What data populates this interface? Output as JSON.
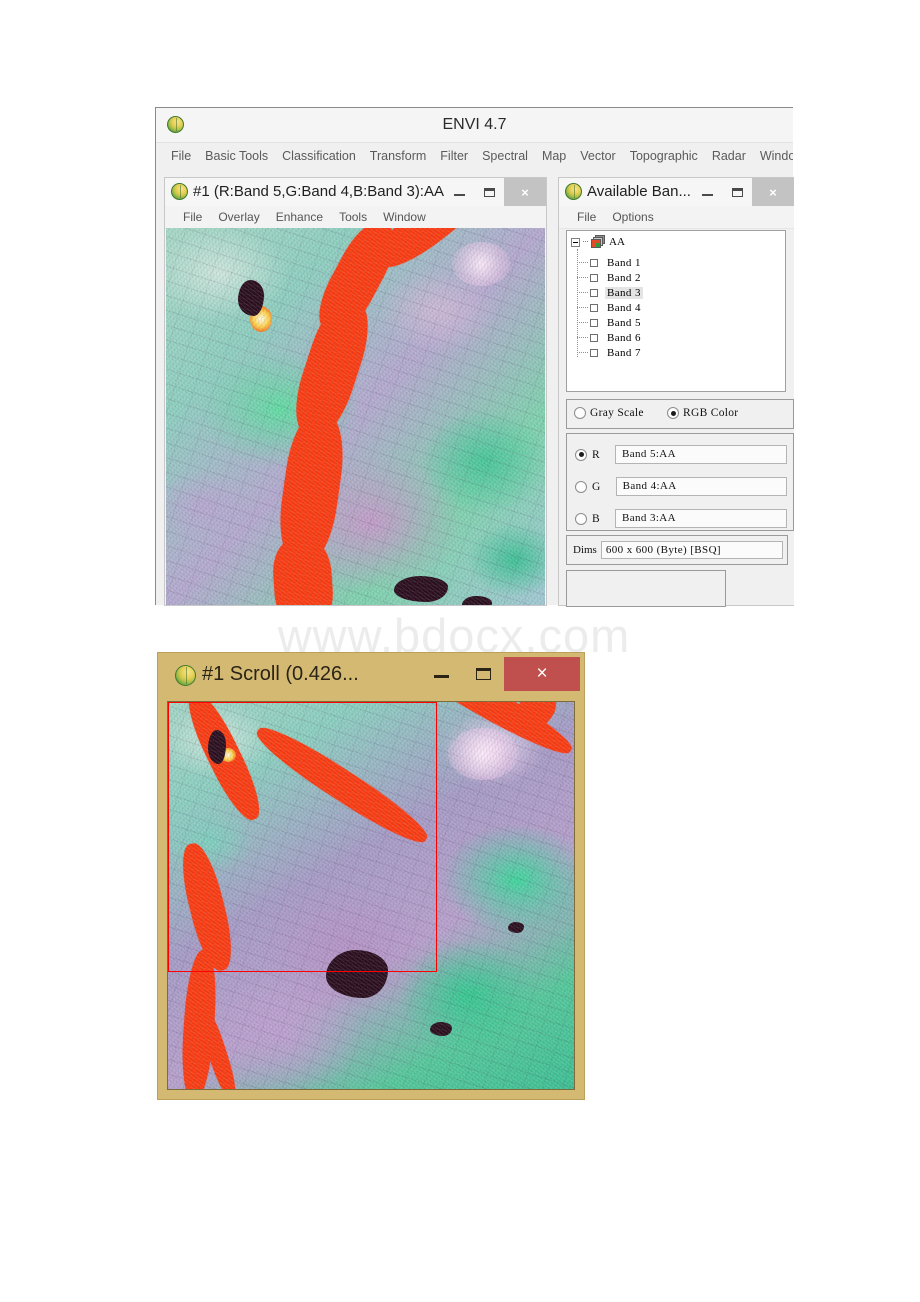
{
  "app": {
    "title": "ENVI 4.7",
    "logo_icon": "envi-globe-icon",
    "menu": [
      "File",
      "Basic Tools",
      "Classification",
      "Transform",
      "Filter",
      "Spectral",
      "Map",
      "Vector",
      "Topographic",
      "Radar",
      "Window"
    ]
  },
  "image_window": {
    "title": "#1 (R:Band 5,G:Band 4,B:Band 3):AA",
    "logo_icon": "envi-globe-icon",
    "menu": [
      "File",
      "Overlay",
      "Enhance",
      "Tools",
      "Window"
    ],
    "controls": {
      "minimize": "–",
      "maximize": "❐",
      "close": "×",
      "close_color": "#c3c3c3"
    },
    "canvas_name": "false-color-satellite-image"
  },
  "bands_window": {
    "title": "Available Ban...",
    "logo_icon": "envi-globe-icon",
    "menu": [
      "File",
      "Options"
    ],
    "controls": {
      "minimize": "–",
      "maximize": "❐",
      "close": "×",
      "close_color": "#c3c3c3"
    },
    "tree": {
      "root_label": "AA",
      "root_icon": "band-stack-icon",
      "expander": "collapse",
      "bands": [
        {
          "label": "Band 1",
          "checked": false,
          "selected": false
        },
        {
          "label": "Band 2",
          "checked": false,
          "selected": false
        },
        {
          "label": "Band 3",
          "checked": false,
          "selected": true
        },
        {
          "label": "Band 4",
          "checked": false,
          "selected": false
        },
        {
          "label": "Band 5",
          "checked": false,
          "selected": false
        },
        {
          "label": "Band 6",
          "checked": false,
          "selected": false
        },
        {
          "label": "Band 7",
          "checked": false,
          "selected": false
        }
      ]
    },
    "mode": {
      "gray_scale_label": "Gray Scale",
      "gray_scale_selected": false,
      "rgb_color_label": "RGB Color",
      "rgb_color_selected": true
    },
    "rgb": [
      {
        "channel": "R",
        "selected": true,
        "value": "Band 5:AA"
      },
      {
        "channel": "G",
        "selected": false,
        "value": "Band 4:AA"
      },
      {
        "channel": "B",
        "selected": false,
        "value": "Band 3:AA"
      }
    ],
    "dims": {
      "label": "Dims",
      "value": "600 x 600 (Byte) [BSQ]"
    }
  },
  "scroll_window": {
    "title": "#1 Scroll (0.426...",
    "logo_icon": "envi-globe-icon",
    "controls": {
      "minimize": "–",
      "maximize": "❐",
      "close": "×",
      "close_color": "#c0504d"
    },
    "titlebar_color": "#d4b972",
    "roi_color": "#ff0000",
    "canvas_name": "false-color-satellite-overview"
  },
  "watermark": {
    "text": "www.bdocx.com",
    "color": "#ececec"
  }
}
